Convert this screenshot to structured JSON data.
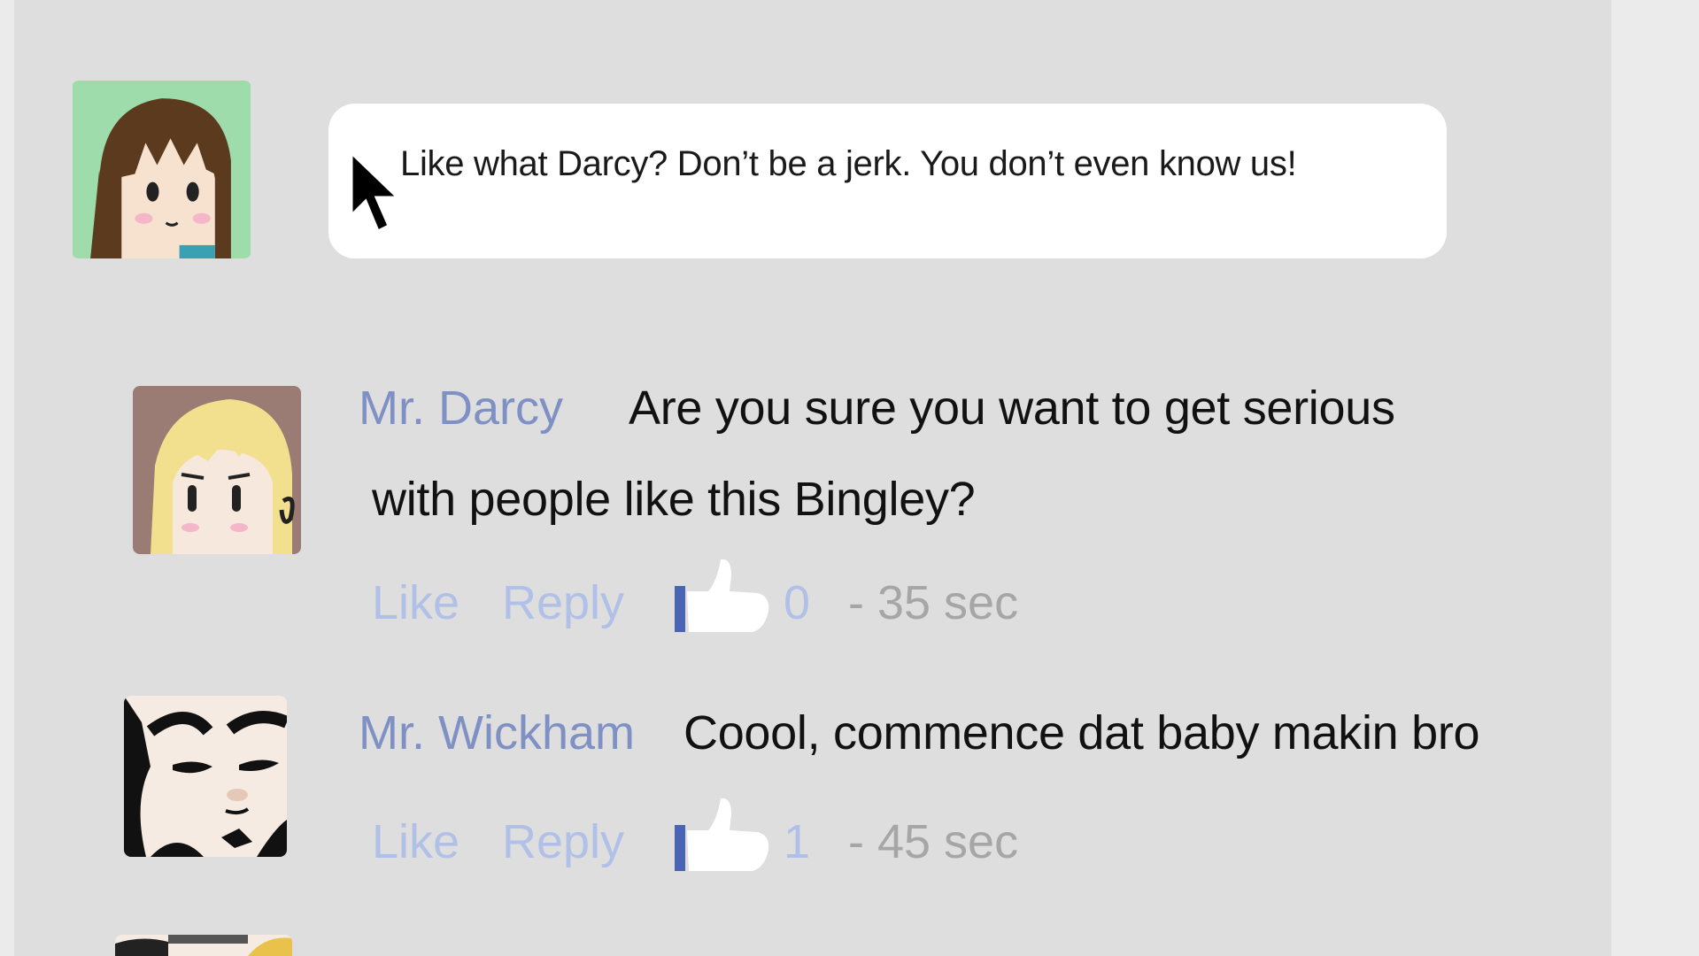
{
  "compose": {
    "text": "Like what Darcy? Don’t be a jerk. You don’t even know us!"
  },
  "comments": [
    {
      "author": "Mr. Darcy",
      "text_line1": "Are you sure you want to get serious",
      "text_line2": "with people like this Bingley?",
      "like_label": "Like",
      "reply_label": "Reply",
      "likes": "0",
      "time": "- 35 sec"
    },
    {
      "author": "Mr. Wickham",
      "text_line1": "Coool, commence dat baby makin bro",
      "like_label": "Like",
      "reply_label": "Reply",
      "likes": "1",
      "time": "- 45 sec"
    }
  ],
  "icons": {
    "cursor": "mouse-pointer-icon",
    "thumbs_up": "thumbs-up-icon"
  },
  "colors": {
    "background": "#dedede",
    "author_name": "#7e90c4",
    "action_link": "#b0c0e6",
    "timestamp": "#a6a6a6",
    "thumb_accent": "#4a64b4"
  }
}
